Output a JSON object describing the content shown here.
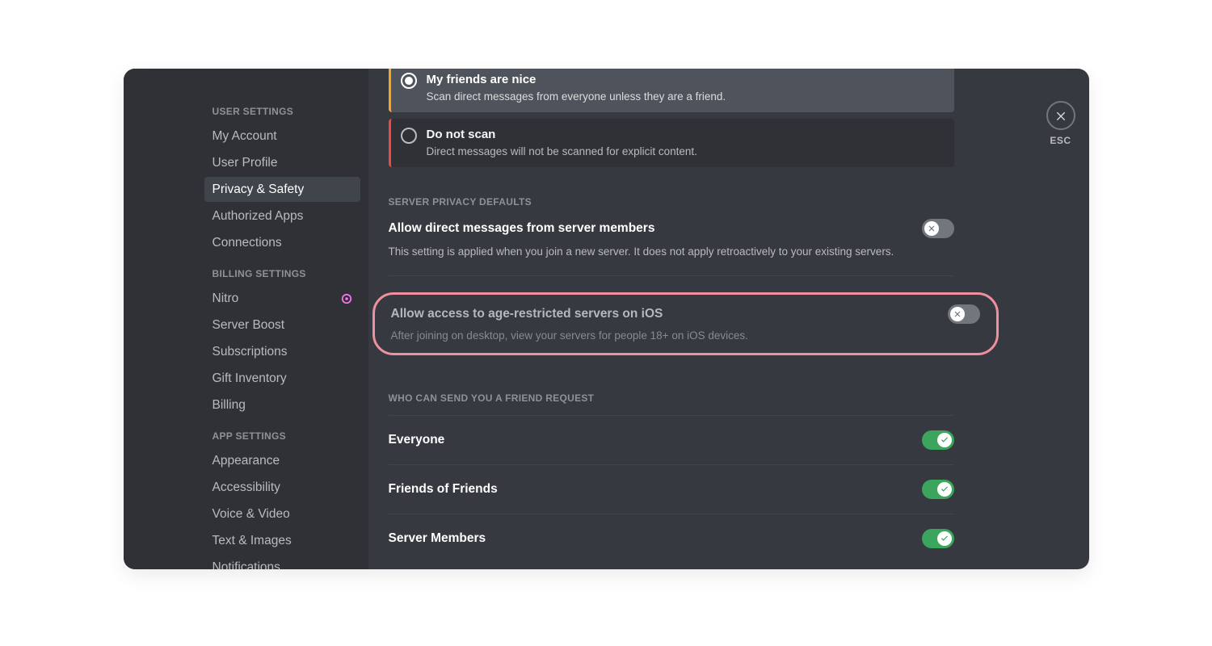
{
  "esc": {
    "label": "ESC"
  },
  "sidebar": {
    "sections": [
      {
        "header": "USER SETTINGS",
        "items": [
          {
            "label": "My Account"
          },
          {
            "label": "User Profile"
          },
          {
            "label": "Privacy & Safety",
            "active": true
          },
          {
            "label": "Authorized Apps"
          },
          {
            "label": "Connections"
          }
        ]
      },
      {
        "header": "BILLING SETTINGS",
        "items": [
          {
            "label": "Nitro",
            "badge": true
          },
          {
            "label": "Server Boost"
          },
          {
            "label": "Subscriptions"
          },
          {
            "label": "Gift Inventory"
          },
          {
            "label": "Billing"
          }
        ]
      },
      {
        "header": "APP SETTINGS",
        "items": [
          {
            "label": "Appearance"
          },
          {
            "label": "Accessibility"
          },
          {
            "label": "Voice & Video"
          },
          {
            "label": "Text & Images"
          },
          {
            "label": "Notifications"
          }
        ]
      }
    ]
  },
  "radios": {
    "option1": {
      "title": "My friends are nice",
      "desc": "Scan direct messages from everyone unless they are a friend."
    },
    "option2": {
      "title": "Do not scan",
      "desc": "Direct messages will not be scanned for explicit content."
    }
  },
  "privacy": {
    "header": "SERVER PRIVACY DEFAULTS",
    "dm": {
      "title": "Allow direct messages from server members",
      "desc": "This setting is applied when you join a new server. It does not apply retroactively to your existing servers."
    },
    "age": {
      "title": "Allow access to age-restricted servers on iOS",
      "desc": "After joining on desktop, view your servers for people 18+ on iOS devices."
    }
  },
  "friends": {
    "header": "WHO CAN SEND YOU A FRIEND REQUEST",
    "options": [
      {
        "label": "Everyone"
      },
      {
        "label": "Friends of Friends"
      },
      {
        "label": "Server Members"
      }
    ]
  }
}
